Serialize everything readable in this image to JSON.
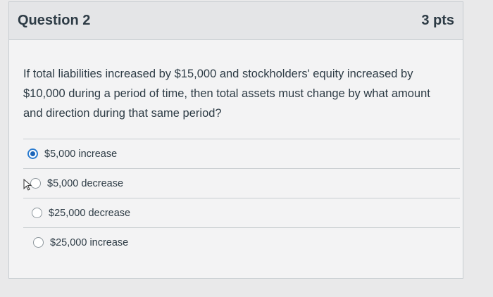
{
  "question": {
    "title": "Question 2",
    "points": "3 pts",
    "text": "If total liabilities increased by $15,000 and stockholders' equity increased by $10,000 during a period of time, then total assets must change by what amount and direction during that same period?"
  },
  "answers": [
    {
      "label": "$5,000 increase",
      "selected": true
    },
    {
      "label": "$5,000 decrease",
      "selected": false
    },
    {
      "label": "$25,000 decrease",
      "selected": false
    },
    {
      "label": "$25,000 increase",
      "selected": false
    }
  ],
  "colors": {
    "selected_radio": "#1a64b8",
    "text": "#2d3b45"
  }
}
